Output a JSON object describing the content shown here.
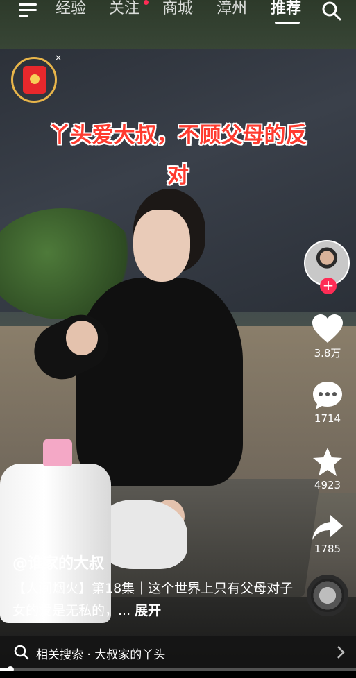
{
  "topbar": {
    "tabs": [
      {
        "label": "经验"
      },
      {
        "label": "关注"
      },
      {
        "label": "商城"
      },
      {
        "label": "漳州"
      },
      {
        "label": "推荐"
      }
    ],
    "active_tab": "推荐",
    "menu_icon": "hamburger-menu-icon",
    "search_icon": "search-icon"
  },
  "overlay": {
    "redpacket_icon": "red-envelope-icon",
    "close_glyph": "×",
    "caption_line1": "丫头爱大叔，不顾父母的反",
    "caption_line2": "对"
  },
  "sidebar": {
    "follow_glyph": "+",
    "likes": "3.8万",
    "comments": "1714",
    "favorites": "4923",
    "shares": "1785"
  },
  "video_info": {
    "author": "@谁家的大叔",
    "description": "【人间烟火】第18集｜这个世界上只有父母对子女的爱是无私的，...",
    "expand_label": "展开"
  },
  "related_search": {
    "label": "相关搜索 · 大叔家的丫头",
    "chevron": "›"
  },
  "playback": {
    "progress_fraction": 0.03
  },
  "colors": {
    "accent_red": "#fe2c55",
    "caption_red": "#ff3b2f",
    "redpacket_gold": "#e8b54a"
  }
}
